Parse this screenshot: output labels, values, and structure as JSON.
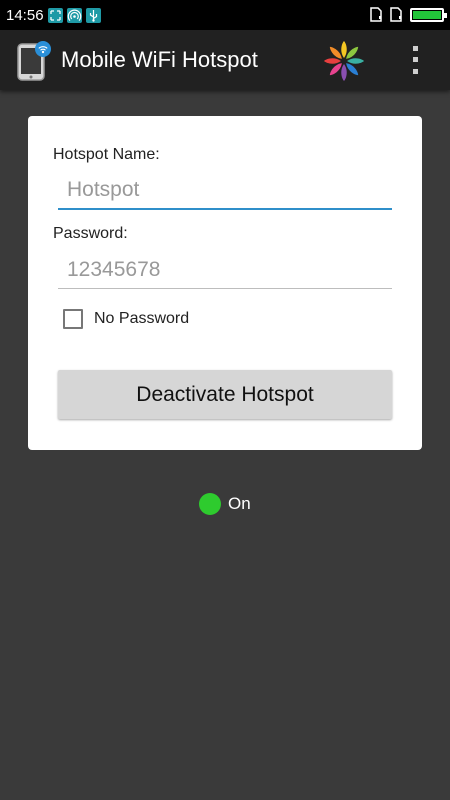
{
  "status_bar": {
    "time": "14:56",
    "icons": [
      "screenshot-icon",
      "wifi-hotspot-icon",
      "usb-icon"
    ],
    "sim_icons": [
      "sim-1-icon",
      "sim-2-icon"
    ],
    "battery_level": 1.0,
    "battery_color": "#22c43a"
  },
  "app_bar": {
    "title": "Mobile WiFi Hotspot",
    "logo_icon": "phone-wifi-icon",
    "flower_icon": "pinwheel-icon",
    "menu_icon": "overflow-menu-icon"
  },
  "form": {
    "hotspot_name_label": "Hotspot Name:",
    "hotspot_name_placeholder": "Hotspot",
    "password_label": "Password:",
    "password_placeholder": "12345678",
    "no_password_label": "No Password",
    "no_password_checked": false,
    "action_button_label": "Deactivate Hotspot"
  },
  "status": {
    "text": "On",
    "color": "#2ecb2e"
  }
}
